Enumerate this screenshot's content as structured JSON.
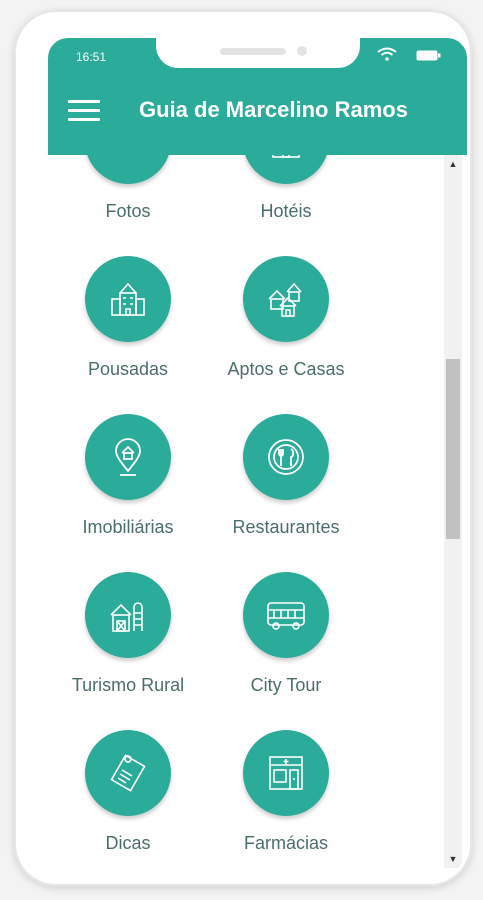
{
  "status_bar": {
    "time": "16:51"
  },
  "app_bar": {
    "title": "Guia de Marcelino Ramos",
    "menu_icon": "hamburger-menu-icon"
  },
  "colors": {
    "primary": "#2bab9a",
    "label": "#4b6e6b",
    "background": "#ffffff"
  },
  "tiles": [
    {
      "label": "Fotos",
      "icon": "camera-icon"
    },
    {
      "label": "Hotéis",
      "icon": "hotel-icon"
    },
    {
      "label": "Pousadas",
      "icon": "inn-building-icon"
    },
    {
      "label": "Aptos e Casas",
      "icon": "houses-icon"
    },
    {
      "label": "Imobiliárias",
      "icon": "location-house-icon"
    },
    {
      "label": "Restaurantes",
      "icon": "plate-cutlery-icon"
    },
    {
      "label": "Turismo Rural",
      "icon": "barn-icon"
    },
    {
      "label": "City Tour",
      "icon": "bus-icon"
    },
    {
      "label": "Dicas",
      "icon": "notes-icon"
    },
    {
      "label": "Farmácias",
      "icon": "pharmacy-icon"
    }
  ],
  "scrollbar": {
    "up_arrow": "▲",
    "down_arrow": "▼"
  }
}
